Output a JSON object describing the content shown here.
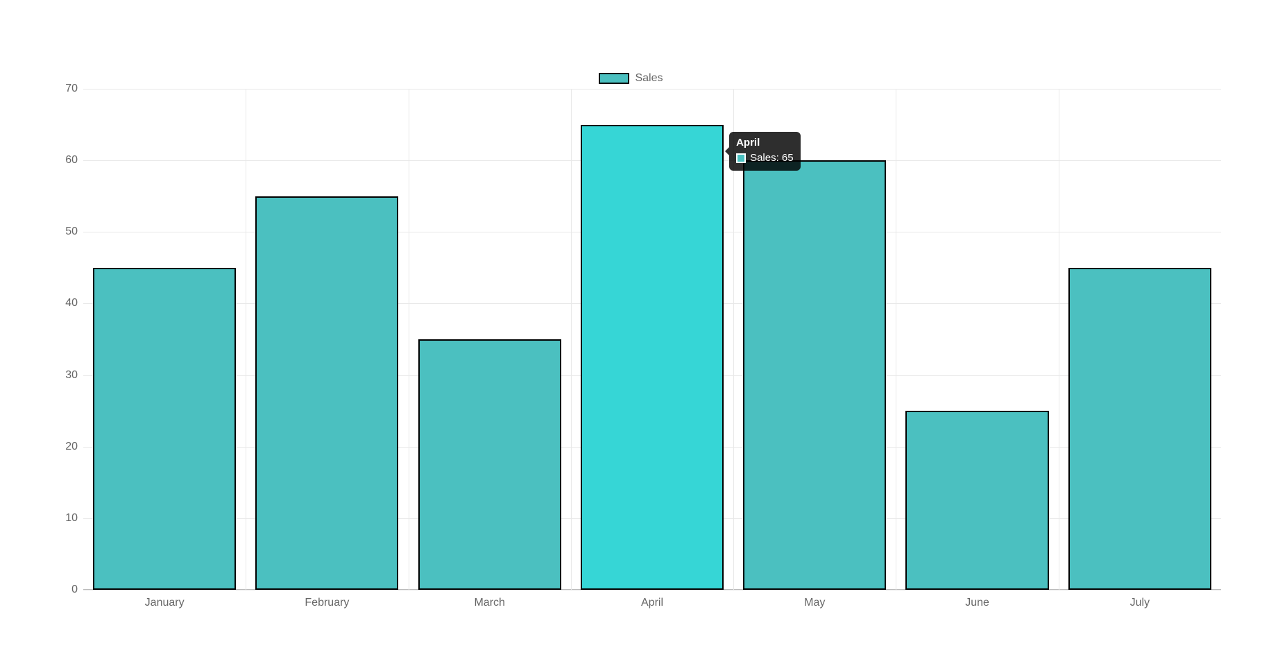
{
  "chart_data": {
    "type": "bar",
    "categories": [
      "January",
      "February",
      "March",
      "April",
      "May",
      "June",
      "July"
    ],
    "values": [
      45,
      55,
      35,
      65,
      60,
      25,
      45
    ],
    "series_name": "Sales",
    "ylim": [
      0,
      70
    ],
    "y_ticks": [
      0,
      10,
      20,
      30,
      40,
      50,
      60,
      70
    ],
    "bar_color": "#4bc0c0",
    "bar_color_hover": "#36d6d6",
    "hover_index": 3
  },
  "legend": {
    "label": "Sales"
  },
  "tooltip": {
    "title": "April",
    "series_label": "Sales",
    "value_text": "65"
  }
}
